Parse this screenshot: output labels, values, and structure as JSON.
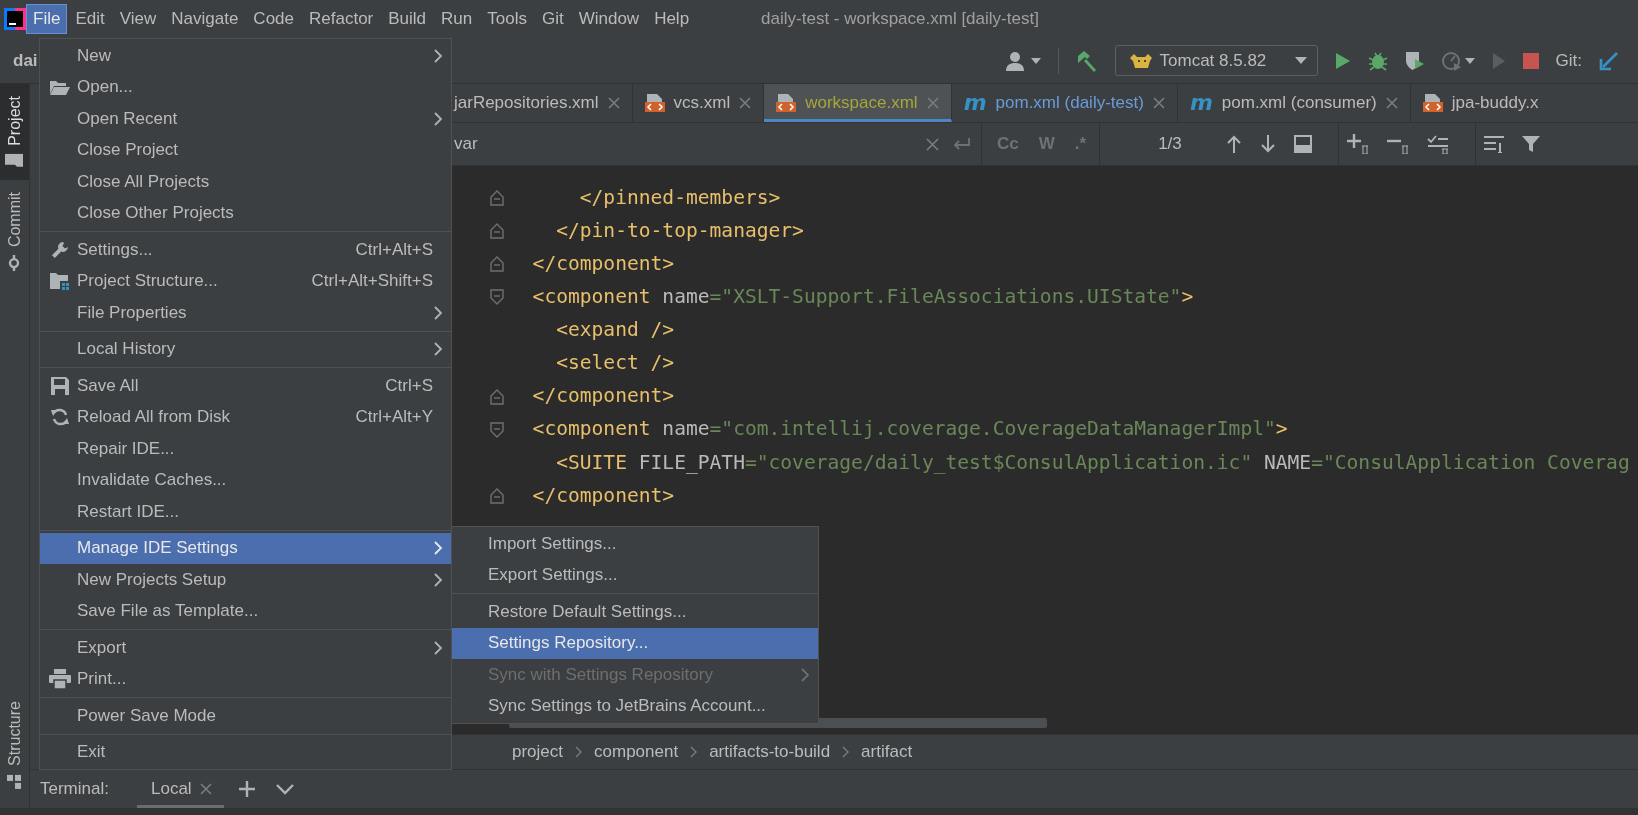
{
  "menubar": {
    "items": [
      {
        "label": "File",
        "selected": true
      },
      {
        "label": "Edit",
        "selected": false
      },
      {
        "label": "View",
        "selected": false
      },
      {
        "label": "Navigate",
        "selected": false
      },
      {
        "label": "Code",
        "selected": false
      },
      {
        "label": "Refactor",
        "selected": false
      },
      {
        "label": "Build",
        "selected": false
      },
      {
        "label": "Run",
        "selected": false
      },
      {
        "label": "Tools",
        "selected": false
      },
      {
        "label": "Git",
        "selected": false
      },
      {
        "label": "Window",
        "selected": false
      },
      {
        "label": "Help",
        "selected": false
      }
    ],
    "title": "daily-test - workspace.xml [daily-test]"
  },
  "toolbar": {
    "project": "dai",
    "run_config": "Tomcat 8.5.82",
    "vcs_label": "Git:"
  },
  "tool_stripe": [
    {
      "kind": "top",
      "label": "Project",
      "selected": true
    },
    {
      "kind": "top",
      "label": "Commit",
      "selected": false
    },
    {
      "kind": "bottom",
      "label": "Structure",
      "selected": false
    }
  ],
  "editor_tabs": [
    {
      "kind": "plain",
      "label": "jarRepositories.xml",
      "color": "#bbbbbb",
      "selected": false,
      "closable": true
    },
    {
      "kind": "xml",
      "label": "vcs.xml",
      "color": "#bbbbbb",
      "selected": false,
      "closable": true
    },
    {
      "kind": "xml",
      "label": "workspace.xml",
      "color": "#a6a63b",
      "selected": true,
      "closable": true
    },
    {
      "kind": "maven",
      "label": "pom.xml (daily-test)",
      "icon_text": "m",
      "color": "#6a9bd8",
      "selected": false,
      "closable": true
    },
    {
      "kind": "maven",
      "label": "pom.xml (consumer)",
      "icon_text": "m",
      "color": "#bbbbbb",
      "selected": false,
      "closable": true
    },
    {
      "kind": "xml",
      "label": "jpa-buddy.x",
      "color": "#bbbbbb",
      "selected": false,
      "closable": false
    }
  ],
  "find_bar": {
    "query": "var",
    "toggles": [
      {
        "label": "Cc",
        "selected": false
      },
      {
        "label": "W",
        "selected": false
      },
      {
        "label": ".*",
        "selected": false
      }
    ],
    "match_count": "1/3"
  },
  "code_lines": [
    {
      "kind": "fold_end",
      "tokens": [
        {
          "kind": "tag",
          "text": "      </pinned-members>"
        }
      ]
    },
    {
      "kind": "fold_end",
      "tokens": [
        {
          "kind": "tag",
          "text": "    </pin-to-top-manager>"
        }
      ]
    },
    {
      "kind": "fold_end",
      "tokens": [
        {
          "kind": "tag",
          "text": "  </component>"
        }
      ]
    },
    {
      "kind": "fold_start",
      "tokens": [
        {
          "kind": "tag",
          "text": "  <component"
        },
        {
          "kind": "attr",
          "text": " name"
        },
        {
          "kind": "value",
          "text": "=\"XSLT-Support.FileAssociations.UIState\""
        },
        {
          "kind": "tag",
          "text": ">"
        }
      ]
    },
    {
      "kind": "plain",
      "tokens": [
        {
          "kind": "tag",
          "text": "    <expand />"
        }
      ]
    },
    {
      "kind": "plain",
      "tokens": [
        {
          "kind": "tag",
          "text": "    <select />"
        }
      ]
    },
    {
      "kind": "fold_end",
      "tokens": [
        {
          "kind": "tag",
          "text": "  </component>"
        }
      ]
    },
    {
      "kind": "fold_start",
      "tokens": [
        {
          "kind": "tag",
          "text": "  <component"
        },
        {
          "kind": "attr",
          "text": " name"
        },
        {
          "kind": "value",
          "text": "=\"com.intellij.coverage.CoverageDataManagerImpl\""
        },
        {
          "kind": "tag",
          "text": ">"
        }
      ]
    },
    {
      "kind": "plain",
      "tokens": [
        {
          "kind": "tag",
          "text": "    <SUITE"
        },
        {
          "kind": "attr",
          "text": " FILE_PATH"
        },
        {
          "kind": "value",
          "text": "=\"coverage/daily_test$ConsulApplication.ic\""
        },
        {
          "kind": "attr",
          "text": " NAME"
        },
        {
          "kind": "value",
          "text": "=\"ConsulApplication Coverag"
        }
      ]
    },
    {
      "kind": "fold_end",
      "tokens": [
        {
          "kind": "tag",
          "text": "  </component>"
        }
      ]
    }
  ],
  "breadcrumbs": [
    "project",
    "component",
    "artifacts-to-build",
    "artifact"
  ],
  "terminal": {
    "label": "Terminal:",
    "tabs": [
      {
        "label": "Local",
        "selected": true
      }
    ]
  },
  "file_menu": {
    "items": [
      {
        "kind": "item",
        "label": "New",
        "submenu": true,
        "selected": false
      },
      {
        "kind": "item",
        "label": "Open...",
        "submenu": false,
        "selected": false
      },
      {
        "kind": "item",
        "label": "Open Recent",
        "submenu": true,
        "selected": false
      },
      {
        "kind": "item",
        "label": "Close Project",
        "submenu": false,
        "selected": false
      },
      {
        "kind": "item",
        "label": "Close All Projects",
        "submenu": false,
        "selected": false
      },
      {
        "kind": "item",
        "label": "Close Other Projects",
        "submenu": false,
        "selected": false
      },
      {
        "kind": "separator"
      },
      {
        "kind": "item",
        "label": "Settings...",
        "shortcut": "Ctrl+Alt+S",
        "submenu": false,
        "selected": false
      },
      {
        "kind": "item",
        "label": "Project Structure...",
        "shortcut": "Ctrl+Alt+Shift+S",
        "submenu": false,
        "selected": false
      },
      {
        "kind": "item",
        "label": "File Properties",
        "submenu": true,
        "selected": false
      },
      {
        "kind": "separator"
      },
      {
        "kind": "item",
        "label": "Local History",
        "submenu": true,
        "selected": false
      },
      {
        "kind": "separator"
      },
      {
        "kind": "item",
        "label": "Save All",
        "shortcut": "Ctrl+S",
        "submenu": false,
        "selected": false
      },
      {
        "kind": "item",
        "label": "Reload All from Disk",
        "shortcut": "Ctrl+Alt+Y",
        "submenu": false,
        "selected": false
      },
      {
        "kind": "item",
        "label": "Repair IDE...",
        "submenu": false,
        "selected": false
      },
      {
        "kind": "item",
        "label": "Invalidate Caches...",
        "submenu": false,
        "selected": false
      },
      {
        "kind": "item",
        "label": "Restart IDE...",
        "submenu": false,
        "selected": false
      },
      {
        "kind": "separator"
      },
      {
        "kind": "item",
        "label": "Manage IDE Settings",
        "submenu": true,
        "selected": true
      },
      {
        "kind": "item",
        "label": "New Projects Setup",
        "submenu": true,
        "selected": false
      },
      {
        "kind": "item",
        "label": "Save File as Template...",
        "submenu": false,
        "selected": false
      },
      {
        "kind": "separator"
      },
      {
        "kind": "item",
        "label": "Export",
        "submenu": true,
        "selected": false
      },
      {
        "kind": "item",
        "label": "Print...",
        "submenu": false,
        "selected": false
      },
      {
        "kind": "separator"
      },
      {
        "kind": "item",
        "label": "Power Save Mode",
        "submenu": false,
        "selected": false
      },
      {
        "kind": "separator"
      },
      {
        "kind": "item",
        "label": "Exit",
        "submenu": false,
        "selected": false
      }
    ]
  },
  "settings_submenu": {
    "items": [
      {
        "kind": "item",
        "label": "Import Settings...",
        "submenu": false,
        "selected": false,
        "disabled": false
      },
      {
        "kind": "item",
        "label": "Export Settings...",
        "submenu": false,
        "selected": false,
        "disabled": false
      },
      {
        "kind": "separator"
      },
      {
        "kind": "item",
        "label": "Restore Default Settings...",
        "submenu": false,
        "selected": false,
        "disabled": false
      },
      {
        "kind": "item",
        "label": "Settings Repository...",
        "submenu": false,
        "selected": true,
        "disabled": false
      },
      {
        "kind": "item",
        "label": "Sync with Settings Repository",
        "submenu": true,
        "selected": false,
        "disabled": true
      },
      {
        "kind": "item",
        "label": "Sync Settings to JetBrains Account...",
        "submenu": false,
        "selected": false,
        "disabled": false
      }
    ]
  }
}
